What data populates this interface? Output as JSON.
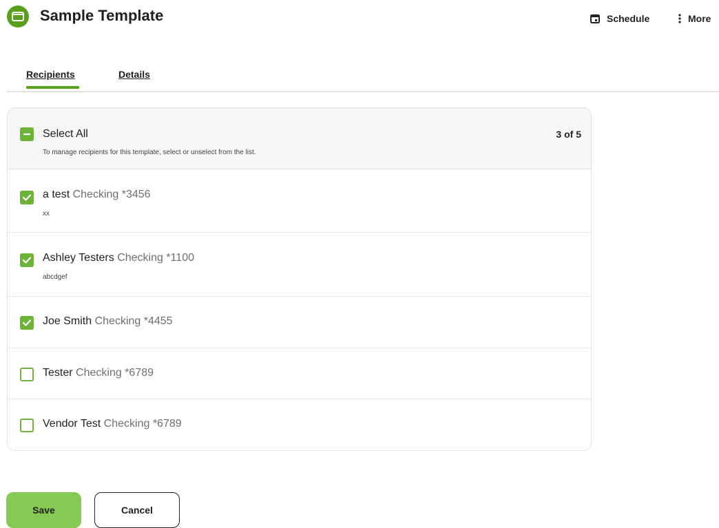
{
  "header": {
    "title": "Sample Template",
    "brand_icon": "template-folder-icon",
    "actions": {
      "schedule": {
        "label": "Schedule",
        "icon": "calendar-icon"
      },
      "more": {
        "label": "More",
        "icon": "vertical-dots-icon"
      }
    }
  },
  "tabs": [
    {
      "label": "Recipients",
      "active": true
    },
    {
      "label": "Details",
      "active": false
    }
  ],
  "select_all": {
    "label": "Select All",
    "help": "To manage recipients for this template, select or unselect from the list.",
    "count": "3 of 5",
    "state": "indeterminate"
  },
  "recipients": [
    {
      "name": "a test",
      "account": "Checking *3456",
      "note": "xx",
      "checked": true
    },
    {
      "name": "Ashley Testers",
      "account": "Checking *1100",
      "note": "abcdgef",
      "checked": true
    },
    {
      "name": "Joe Smith",
      "account": "Checking *4455",
      "note": "",
      "checked": true
    },
    {
      "name": "Tester",
      "account": "Checking *6789",
      "note": "",
      "checked": false
    },
    {
      "name": "Vendor Test",
      "account": "Checking *6789",
      "note": "",
      "checked": false
    }
  ],
  "buttons": {
    "save": "Save",
    "cancel": "Cancel"
  },
  "colors": {
    "brand_green": "#5a9e1e",
    "checkbox_green": "#6cb338",
    "save_button": "#86c955"
  }
}
